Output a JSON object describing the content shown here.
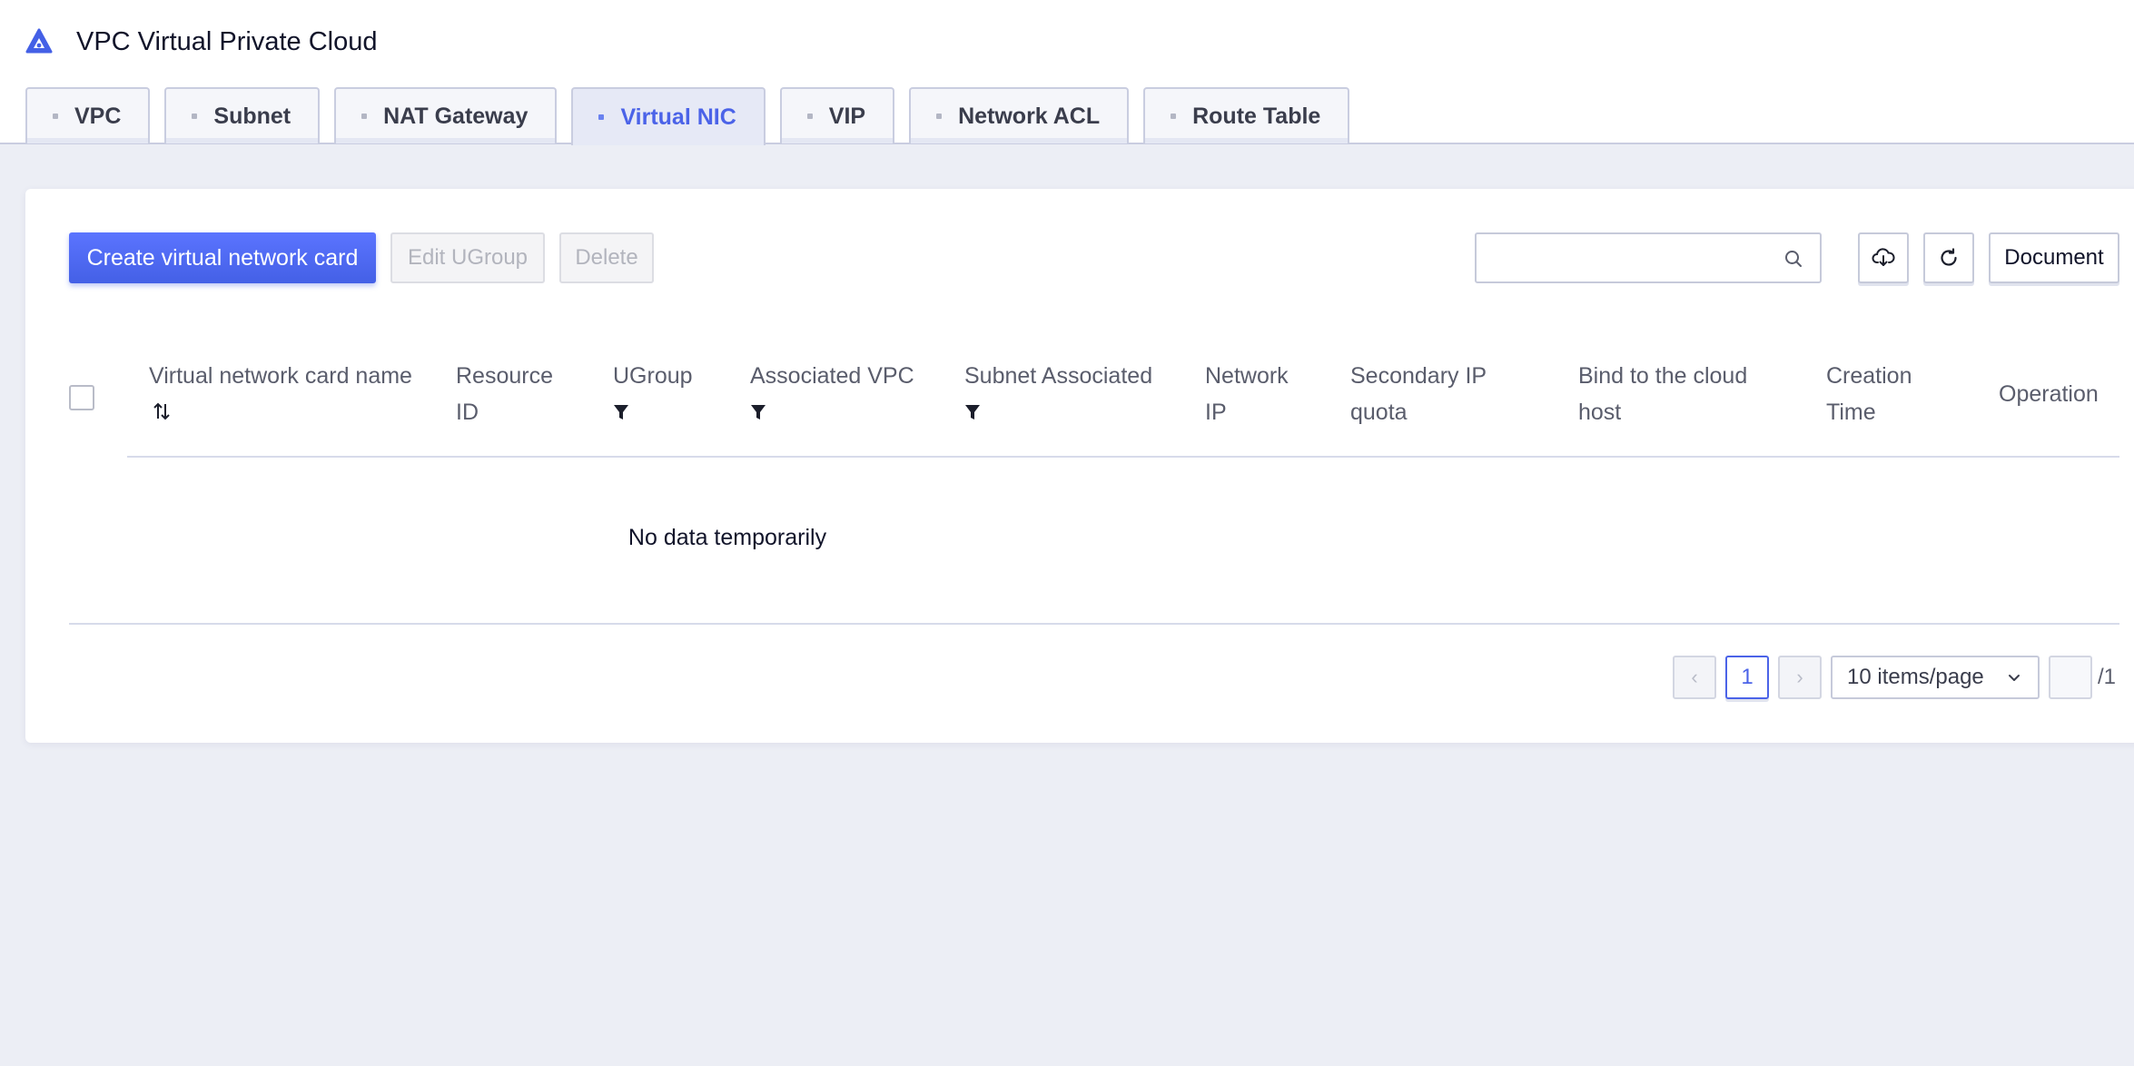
{
  "header": {
    "title": "VPC Virtual Private Cloud",
    "logo_icon": "vpc-logo-icon",
    "brand_color": "#4460e6"
  },
  "tabs": [
    {
      "label": "VPC",
      "active": false
    },
    {
      "label": "Subnet",
      "active": false
    },
    {
      "label": "NAT Gateway",
      "active": false
    },
    {
      "label": "Virtual NIC",
      "active": true
    },
    {
      "label": "VIP",
      "active": false
    },
    {
      "label": "Network ACL",
      "active": false
    },
    {
      "label": "Route Table",
      "active": false
    }
  ],
  "toolbar": {
    "create_label": "Create virtual network card",
    "edit_ugroup_label": "Edit UGroup",
    "delete_label": "Delete",
    "search_placeholder": "",
    "search_value": "",
    "download_icon": "cloud-download-icon",
    "refresh_icon": "refresh-icon",
    "document_label": "Document"
  },
  "table": {
    "columns": [
      {
        "line1": "Virtual network card name",
        "line2": "",
        "control": "sort"
      },
      {
        "line1": "Resource",
        "line2": "ID",
        "control": ""
      },
      {
        "line1": "UGroup",
        "line2": "",
        "control": "filter"
      },
      {
        "line1": "Associated VPC",
        "line2": "",
        "control": "filter"
      },
      {
        "line1": "Subnet Associated",
        "line2": "",
        "control": "filter"
      },
      {
        "line1": "Network",
        "line2": "IP",
        "control": ""
      },
      {
        "line1": "Secondary IP",
        "line2": "quota",
        "control": ""
      },
      {
        "line1": "Bind to the cloud",
        "line2": "host",
        "control": ""
      },
      {
        "line1": "Creation",
        "line2": "Time",
        "control": ""
      },
      {
        "line1": "Operation",
        "line2": "",
        "control": ""
      }
    ],
    "rows": [],
    "empty_text": "No data temporarily"
  },
  "pagination": {
    "prev_label": "‹",
    "current_page": "1",
    "next_label": "›",
    "page_size": "10 items/page",
    "jump_value": "",
    "total_pages": "/1"
  }
}
